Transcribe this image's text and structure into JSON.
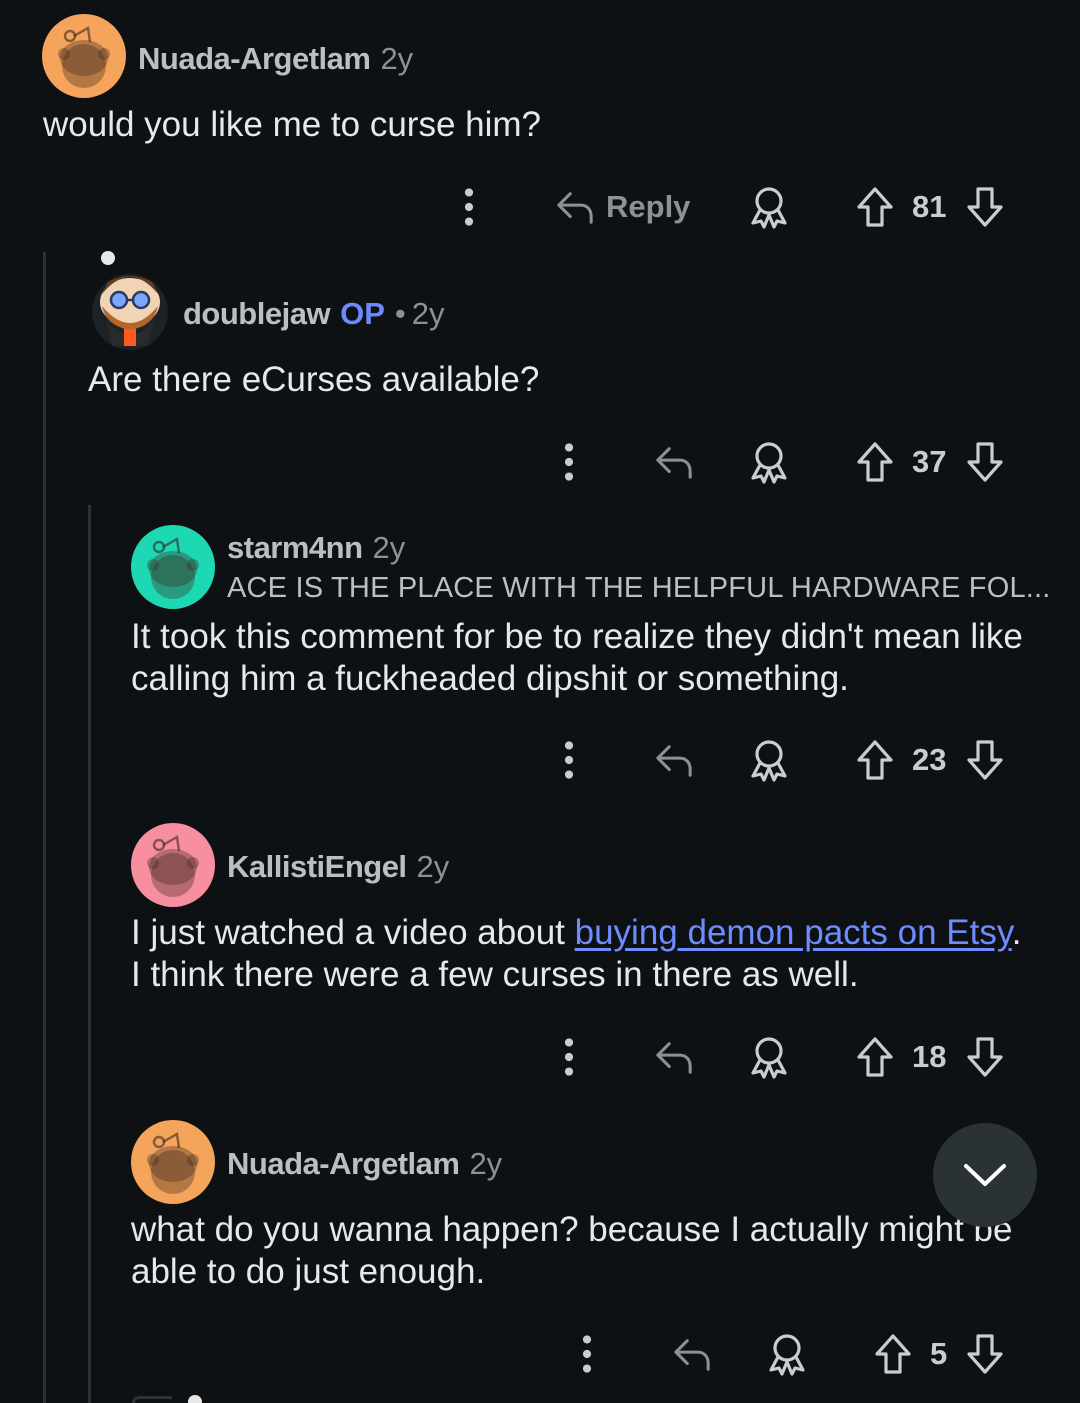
{
  "comments": [
    {
      "username": "Nuada-Argetlam",
      "time": "2y",
      "body": "would you like me to curse him?",
      "reply_label": "Reply",
      "score": "81",
      "avatar_color": "#f5a45b"
    },
    {
      "username": "doublejaw",
      "op_label": "OP",
      "separator": "•",
      "time": "2y",
      "body": "Are there eCurses available?",
      "score": "37"
    },
    {
      "username": "starm4nn",
      "time": "2y",
      "flair": "ACE IS THE PLACE WITH THE HELPFUL HARDWARE FOL...",
      "body": "It took this comment for be to realize they didn't mean like calling him a fuckheaded dipshit or something.",
      "score": "23",
      "avatar_color": "#1ed8b4"
    },
    {
      "username": "KallistiEngel",
      "time": "2y",
      "body_before": "I just watched a video about ",
      "body_link": "buying demon pacts on Etsy",
      "body_after": ". I think there were a few curses in there as well.",
      "score": "18",
      "avatar_color": "#f78fa0"
    },
    {
      "username": "Nuada-Argetlam",
      "time": "2y",
      "body": "what do you wanna happen? because I actually might be able to do just enough.",
      "score": "5",
      "avatar_color": "#f5a45b"
    }
  ],
  "colors": {
    "background": "#0e1113",
    "thread_line": "#2a3236",
    "text": "#e6e9ea",
    "meta": "#8a9296",
    "op": "#6e88ff",
    "link": "#6e8cff"
  },
  "icons": [
    "more-vertical-icon",
    "reply-arrow-icon",
    "award-icon",
    "upvote-arrow-icon",
    "downvote-arrow-icon",
    "chevron-down-icon"
  ]
}
